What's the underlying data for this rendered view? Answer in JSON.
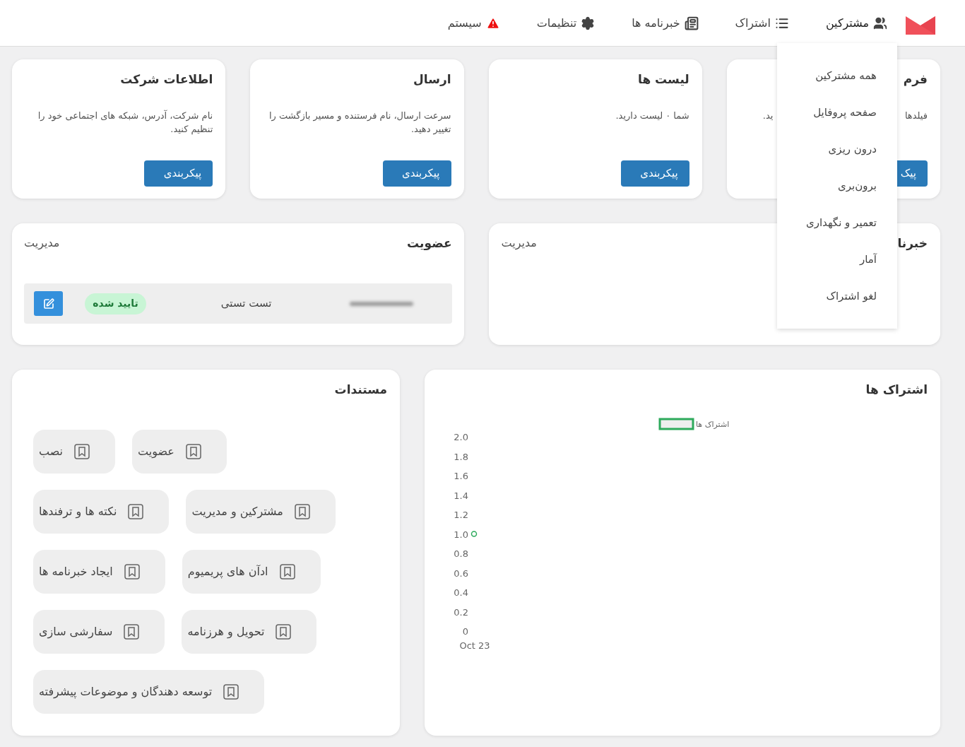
{
  "nav": {
    "items": [
      {
        "label": "مشترکین",
        "expanded": true
      },
      {
        "label": "اشتراک",
        "expanded": false
      },
      {
        "label": "خبرنامه ها",
        "expanded": false
      },
      {
        "label": "تنظیمات",
        "expanded": false
      },
      {
        "label": "سیستم",
        "expanded": false
      }
    ]
  },
  "subscribers_menu": [
    "همه مشترکین",
    "صفحه پروفایل",
    "درون ریزی",
    "برون‌بری",
    "تعمیر و نگهداری",
    "آمار",
    "لغو اشتراک"
  ],
  "config_cards": [
    {
      "title": "فرم",
      "description_parts": [
        "فیلدها",
        "ید."
      ],
      "button": "پیک"
    },
    {
      "title": "لیست ها",
      "description_parts": [
        "شما ۰ لیست دارید."
      ],
      "button": "پیکربندی"
    },
    {
      "title": "ارسال",
      "description_parts": [
        "سرعت ارسال، نام فرستنده و مسیر بازگشت را تغییر دهید."
      ],
      "button": "پیکربندی"
    },
    {
      "title": "اطلاعات شرکت",
      "description_parts": [
        "نام شرکت، آدرس، شبکه های اجتماعی خود را تنظیم کنید."
      ],
      "button": "پیکربندی"
    }
  ],
  "newsletters_card": {
    "title": "خبرنا",
    "link": "مدیریت"
  },
  "membership_card": {
    "title": "عضویت",
    "link": "مدیریت",
    "row": {
      "name": "تست تستی",
      "status": "تایید شده"
    }
  },
  "subscriptions_card": {
    "title": "اشتراک ها",
    "chart_data": {
      "type": "line",
      "categories": [
        "Oct 23"
      ],
      "series": [
        {
          "name": "اشتراک ها",
          "color": "#2eaa5c",
          "marker": "circle",
          "values": [
            1
          ]
        }
      ],
      "ylim": [
        0,
        2
      ],
      "yticks": [
        {
          "value": 2,
          "label": "2.0"
        },
        {
          "value": 1.8,
          "label": "1.8"
        },
        {
          "value": 1.6,
          "label": "1.6"
        },
        {
          "value": 1.4,
          "label": "1.4"
        },
        {
          "value": 1.2,
          "label": "1.2"
        },
        {
          "value": 1,
          "label": "1.0"
        },
        {
          "value": 0.8,
          "label": "0.8"
        },
        {
          "value": 0.6,
          "label": "0.6"
        },
        {
          "value": 0.4,
          "label": "0.4"
        },
        {
          "value": 0.2,
          "label": "0.2"
        },
        {
          "value": 0,
          "label": "0"
        }
      ]
    }
  },
  "docs_card": {
    "title": "مستندات",
    "links": [
      "عضویت",
      "نصب",
      "مشترکین و مدیریت",
      "نکته ها و ترفندها",
      "ادآن های پریمیوم",
      "ایجاد خبرنامه ها",
      "تحویل و هرزنامه",
      "سفارشی سازی",
      "توسعه دهندگان و موضوعات پیشرفته"
    ]
  }
}
